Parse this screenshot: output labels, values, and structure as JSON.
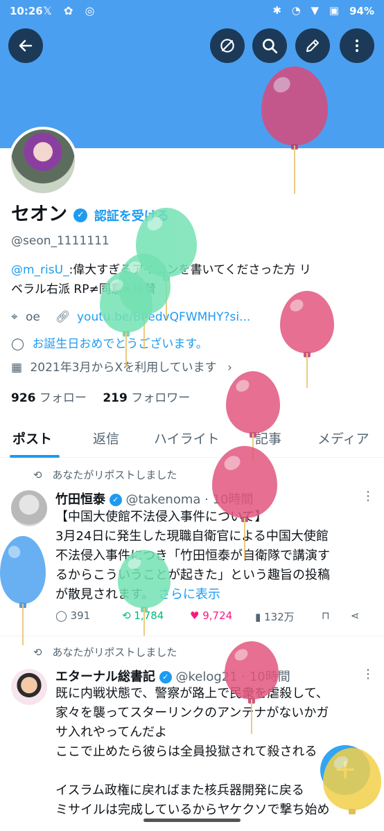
{
  "status_bar": {
    "time": "10:26",
    "battery": "94%"
  },
  "profile": {
    "name": "セオン",
    "verify_label": "認証を受ける",
    "handle": "@seon_1111111",
    "bio_mention": "@m_risU_",
    "bio_text": ":偉大すぎるアイコンを書いてくださった方 リ",
    "bio_text2": "ベラル右派 RP≠同意≠称賛",
    "location": "oe",
    "website": "youtu.be/BPedvQFWMHY?si...",
    "birthday": "お誕生日おめでとうございます。",
    "joined": "2021年3月からXを利用しています",
    "following_count": "926",
    "following_label": "フォロー",
    "followers_count": "219",
    "followers_label": "フォロワー"
  },
  "tabs": [
    "ポスト",
    "返信",
    "ハイライト",
    "記事",
    "メディア"
  ],
  "posts": [
    {
      "repost_label": "あなたがリポストしました",
      "author": "竹田恒泰",
      "handle": "@takenoma",
      "time": "· 10時間",
      "lines": [
        "【中国大使館不法侵入事件について】",
        "3月24日に発生した現職自衛官による中国大使館",
        "不法侵入事件につき「竹田恒泰が自衛隊で講演す",
        "るからこういうことが起きた」という趣旨の投稿",
        "が散見されます。"
      ],
      "show_more": "さらに表示",
      "replies": "391",
      "reposts": "1,784",
      "likes": "9,724",
      "views": "132万"
    },
    {
      "repost_label": "あなたがリポストしました",
      "author": "エターナル総書記",
      "handle": "@kelog21",
      "time": "· 10時間",
      "lines": [
        "既に内戦状態で、警察が路上で民衆を虐殺して、",
        "家々を襲ってスターリンクのアンテナがないかガ",
        "サ入れやってんだよ",
        "ここで止めたら彼らは全員投獄されて殺される",
        "",
        "イスラム政権に戻ればまた核兵器開発に戻る",
        "ミサイルは完成しているからヤケクソで撃ち始め"
      ]
    }
  ],
  "colors": {
    "accent": "#1d9bf0",
    "banner": "#4b9ff0",
    "like": "#f91880",
    "repost": "#00ba7c"
  }
}
